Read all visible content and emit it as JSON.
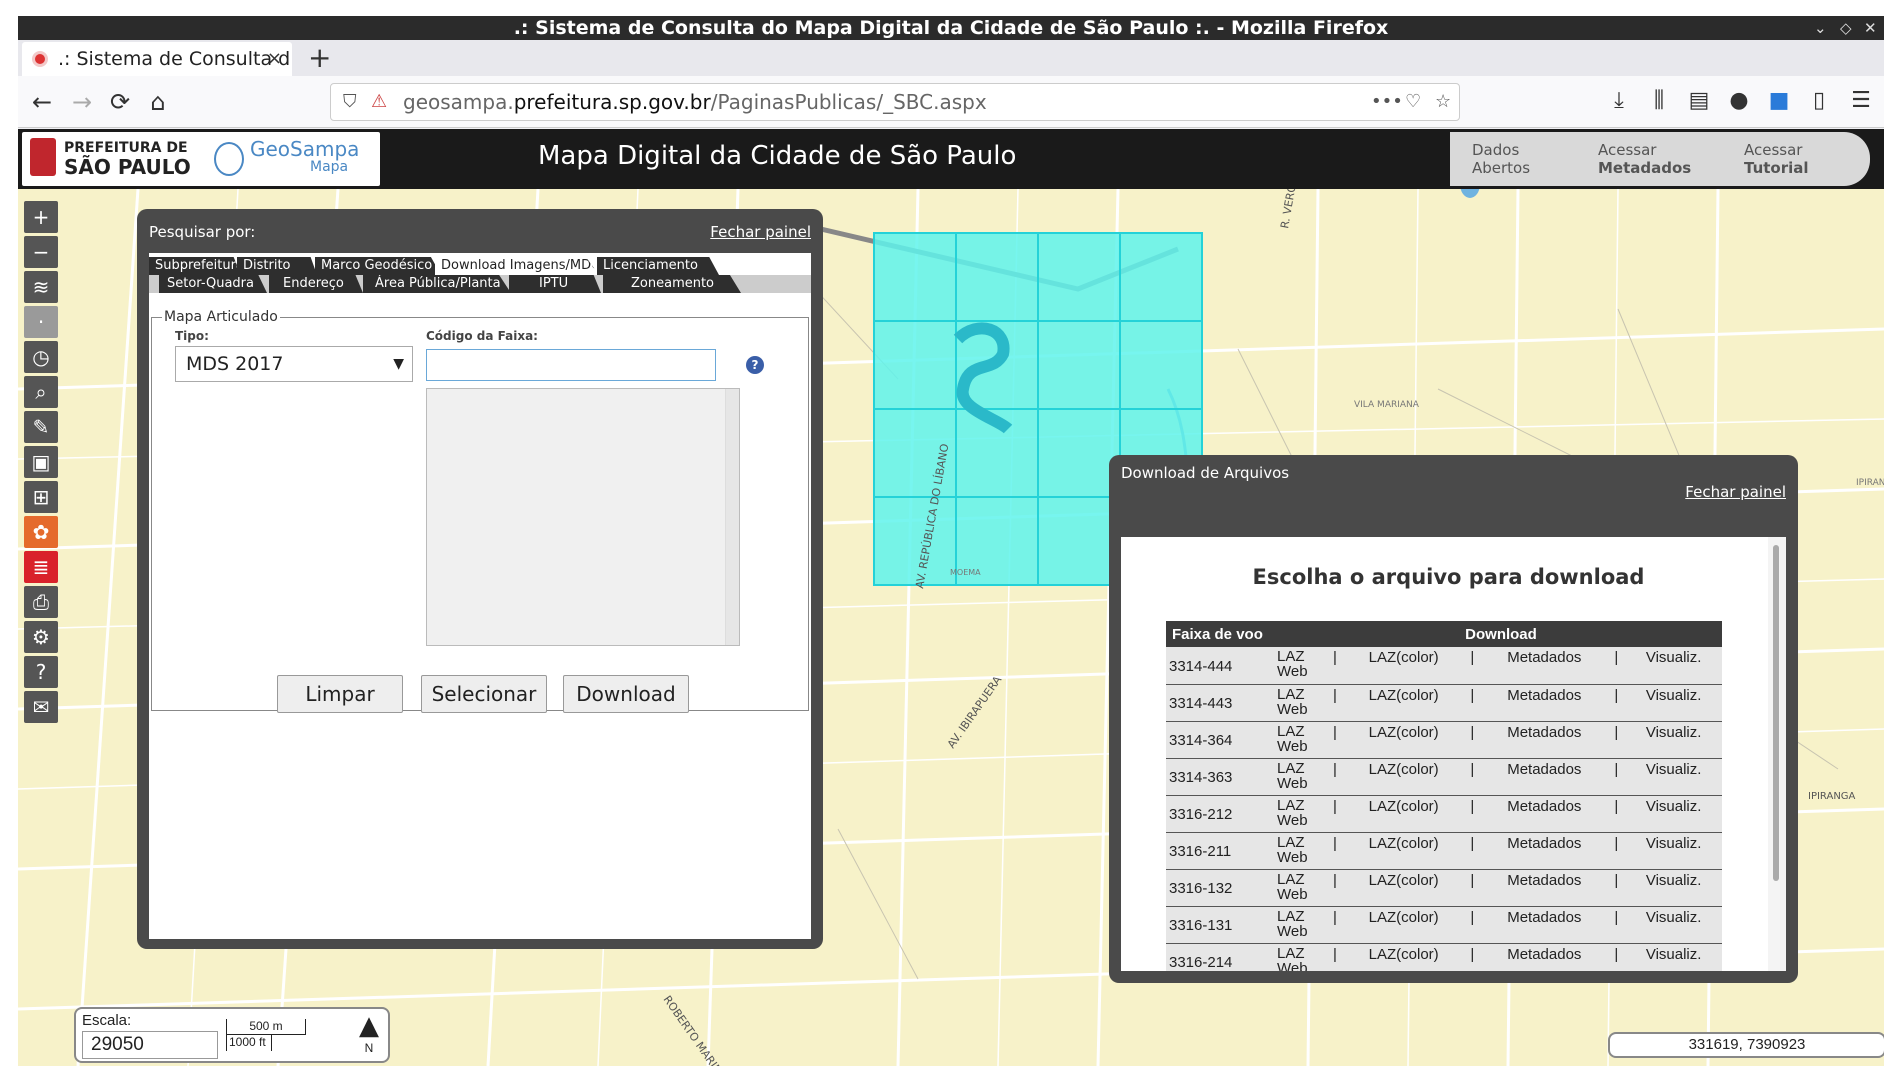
{
  "window": {
    "title": ".: Sistema de Consulta do Mapa Digital da Cidade de São Paulo :. - Mozilla Firefox"
  },
  "tab": {
    "label": ".: Sistema de Consulta d",
    "close": "×"
  },
  "newtab": "+",
  "url": {
    "prefix": "geosampa.",
    "domain": "prefeitura.sp.gov.br",
    "path": "/PaginasPublicas/_SBC.aspx"
  },
  "header": {
    "logo_line1": "PREFEITURA DE",
    "logo_line2": "SÃO PAULO",
    "geo_line1": "GeoSampa",
    "geo_line2": "Mapa",
    "title": "Mapa Digital da Cidade de São Paulo",
    "buttons": [
      {
        "line1": "Dados",
        "line2": "Abertos"
      },
      {
        "line1": "Acessar",
        "line2": "Metadados"
      },
      {
        "line1": "Acessar",
        "line2": "Tutorial"
      }
    ]
  },
  "search_panel": {
    "title": "Pesquisar por:",
    "close": "Fechar painel",
    "tabs_row1": [
      "Subprefeitura",
      "Distrito",
      "Marco Geodésico",
      "Download Imagens/MDC",
      "Licenciamento"
    ],
    "tabs_row2": [
      "Setor-Quadra",
      "Endereço",
      "Área Pública/Planta",
      "IPTU",
      "Zoneamento"
    ],
    "fieldset_legend": "Mapa Articulado",
    "tipo_label": "Tipo:",
    "tipo_value": "MDS 2017",
    "codigo_label": "Código da Faixa:",
    "info_icon": "?",
    "buttons": {
      "limpar": "Limpar",
      "selecionar": "Selecionar",
      "download": "Download"
    }
  },
  "download_panel": {
    "title": "Download de Arquivos",
    "close": "Fechar painel",
    "heading": "Escolha o arquivo para download",
    "columns": [
      "Faixa de voo",
      "Download"
    ],
    "link_labels": {
      "laz": "LAZ Web",
      "laz_color": "LAZ(color)",
      "meta": "Metadados",
      "vis": "Visualiz.",
      "sep": "|"
    },
    "rows": [
      {
        "faixa": "3314-444"
      },
      {
        "faixa": "3314-443"
      },
      {
        "faixa": "3314-364"
      },
      {
        "faixa": "3314-363"
      },
      {
        "faixa": "3316-212"
      },
      {
        "faixa": "3316-211"
      },
      {
        "faixa": "3316-132"
      },
      {
        "faixa": "3316-131"
      },
      {
        "faixa": "3316-214"
      }
    ]
  },
  "scale": {
    "label": "Escala:",
    "value": "29050",
    "bar_m": "500 m",
    "bar_ft": "1000 ft",
    "north": "N"
  },
  "coords": "331619, 7390923",
  "map_labels": {
    "av_rep_libano": "AV. REPÚBLICA DO LÍBANO",
    "av_ibirapuera": "AV. IBIRAPUERA",
    "vila_mariana": "VILA MARIANA",
    "ipiranga1": "IPIRANGA",
    "ipiranga2": "IPIRANGA",
    "roberto_marinho": "ROBERTO MARINHO",
    "r_vergueiro": "R. VERGUEIRO",
    "moema": "MOEMA"
  },
  "colors": {
    "map_bg": "#f7f2c9",
    "grid_fill": "#5ff3ec",
    "panel": "#4a4a4a",
    "orange_tool": "#e56a2c",
    "red_tool": "#d9222a"
  }
}
